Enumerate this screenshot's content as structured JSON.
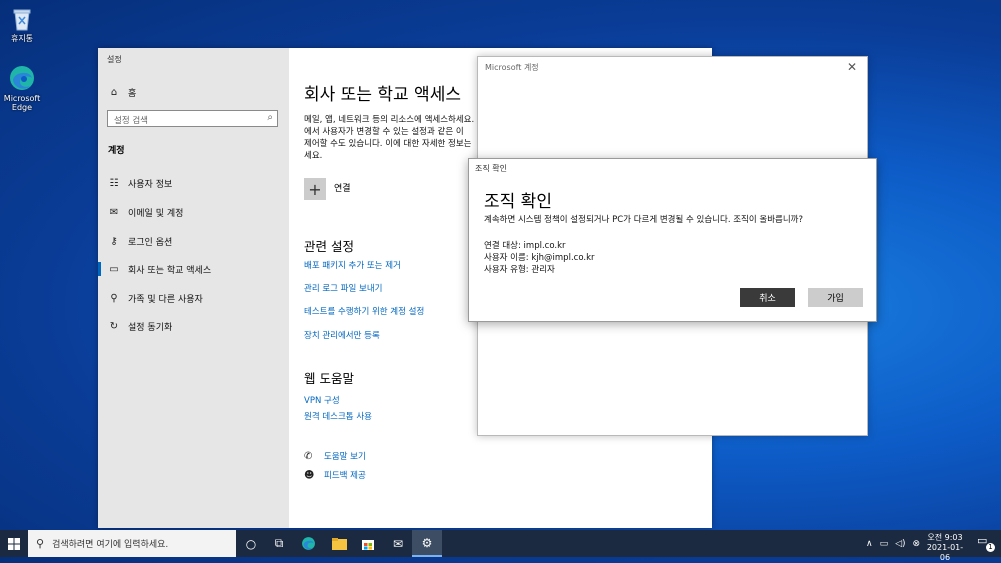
{
  "desktop": {
    "icons": [
      {
        "label": "휴지통",
        "icon": "recycle-bin-icon"
      },
      {
        "label": "Microsoft Edge",
        "icon": "edge-icon"
      }
    ]
  },
  "settings": {
    "window_title": "설정",
    "sidebar": {
      "home": "홈",
      "search_placeholder": "설정 검색",
      "section": "계정",
      "items": [
        {
          "label": "사용자 정보",
          "icon": "user-info-icon"
        },
        {
          "label": "이메일 및 계정",
          "icon": "mail-icon"
        },
        {
          "label": "로그인 옵션",
          "icon": "key-icon"
        },
        {
          "label": "회사 또는 학교 액세스",
          "icon": "briefcase-icon",
          "active": true
        },
        {
          "label": "가족 및 다른 사용자",
          "icon": "person-add-icon"
        },
        {
          "label": "설정 동기화",
          "icon": "sync-icon"
        }
      ]
    },
    "main": {
      "title": "회사 또는 학교 액세스",
      "description": "메일, 앱, 네트워크 등의 리소스에 액세스하세요.\n에서 사용자가 변경할 수 있는 설정과 같은 이\n제어할 수도 있습니다. 이에 대한 자세한 정보는\n세요.",
      "connect_label": "연결",
      "related_title": "관련 설정",
      "related_links": [
        "배포 패키지 추가 또는 제거",
        "관리 로그 파일 보내기",
        "테스트를 수행하기 위한 계정 설정",
        "장치 관리에서만 등록"
      ],
      "web_help_title": "웹 도움말",
      "web_links": [
        "VPN 구성",
        "원격 데스크톱 사용"
      ],
      "help_items": [
        {
          "label": "도움말 보기",
          "icon": "help-chat-icon"
        },
        {
          "label": "피드백 제공",
          "icon": "feedback-icon"
        }
      ]
    }
  },
  "ms_account": {
    "title": "Microsoft 계정"
  },
  "dialog": {
    "title": "조직 확인",
    "heading": "조직 확인",
    "message": "계속하면 시스템 정책이 설정되거나 PC가 다르게 변경될 수 있습니다. 조직이 올바릅니까?",
    "details": [
      "연결 대상: impl.co.kr",
      "사용자 이름: kjh@impl.co.kr",
      "사용자 유형: 관리자"
    ],
    "cancel": "취소",
    "join": "가입"
  },
  "taskbar": {
    "search_placeholder": "검색하려면 여기에 입력하세요.",
    "time": "오전 9:03",
    "date": "2021-01-06",
    "notification_count": "1"
  }
}
